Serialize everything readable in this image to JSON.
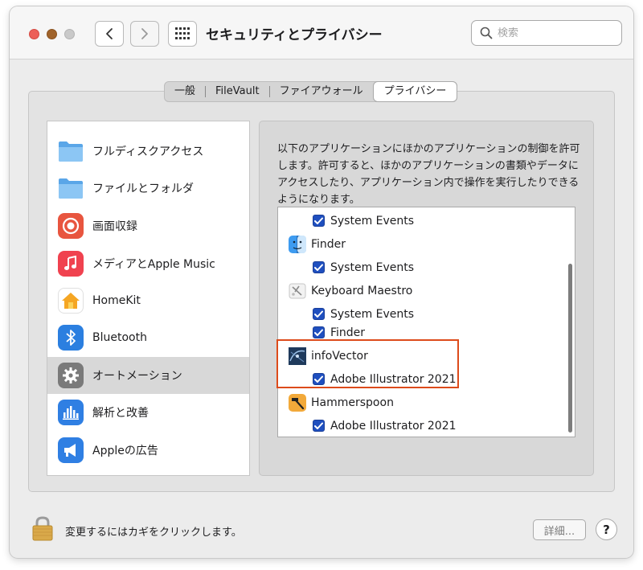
{
  "window": {
    "title": "セキュリティとプライバシー",
    "search_placeholder": "検索",
    "icons": {
      "back": "chevron-left-icon",
      "forward": "chevron-right-icon",
      "grid": "grid-icon",
      "search": "search-icon"
    }
  },
  "tabs": [
    {
      "label": "一般",
      "active": false
    },
    {
      "label": "FileVault",
      "active": false
    },
    {
      "label": "ファイアウォール",
      "active": false
    },
    {
      "label": "プライバシー",
      "active": true
    }
  ],
  "sidebar": {
    "items": [
      {
        "label": "フルディスクアクセス",
        "icon": "folder-icon",
        "selected": false
      },
      {
        "label": "ファイルとフォルダ",
        "icon": "folder-icon",
        "selected": false
      },
      {
        "label": "画面収録",
        "icon": "screen-record-icon",
        "selected": false
      },
      {
        "label": "メディアとApple Music",
        "icon": "music-icon",
        "selected": false
      },
      {
        "label": "HomeKit",
        "icon": "home-icon",
        "selected": false
      },
      {
        "label": "Bluetooth",
        "icon": "bluetooth-icon",
        "selected": false
      },
      {
        "label": "オートメーション",
        "icon": "gear-icon",
        "selected": true
      },
      {
        "label": "解析と改善",
        "icon": "chart-icon",
        "selected": false
      },
      {
        "label": "Appleの広告",
        "icon": "megaphone-icon",
        "selected": false
      }
    ]
  },
  "main": {
    "description": "以下のアプリケーションにほかのアプリケーションの制御を許可します。許可すると、ほかのアプリケーションの書類やデータにアクセスしたり、アプリケーション内で操作を実行したりできるようになります。",
    "list": [
      {
        "kind": "checkbox",
        "label": "System Events",
        "checked": true
      },
      {
        "kind": "app",
        "label": "Finder",
        "icon": "finder-icon"
      },
      {
        "kind": "checkbox",
        "label": "System Events",
        "checked": true
      },
      {
        "kind": "app",
        "label": "Keyboard Maestro",
        "icon": "keyboard-maestro-icon"
      },
      {
        "kind": "checkbox",
        "label": "System Events",
        "checked": true
      },
      {
        "kind": "checkbox",
        "label": "Finder",
        "checked": true
      },
      {
        "kind": "app",
        "label": "infoVector",
        "icon": "infovector-icon"
      },
      {
        "kind": "checkbox",
        "label": "Adobe Illustrator 2021",
        "checked": true
      },
      {
        "kind": "app",
        "label": "Hammerspoon",
        "icon": "hammerspoon-icon"
      },
      {
        "kind": "checkbox",
        "label": "Adobe Illustrator 2021",
        "checked": true
      }
    ]
  },
  "footer": {
    "lock_text": "変更するにはカギをクリックします。",
    "detail_button": "詳細...",
    "help_button": "?"
  },
  "colors": {
    "accent": "#1f4fbf",
    "highlight": "#dd4b1b",
    "close": "#ec5f58"
  }
}
